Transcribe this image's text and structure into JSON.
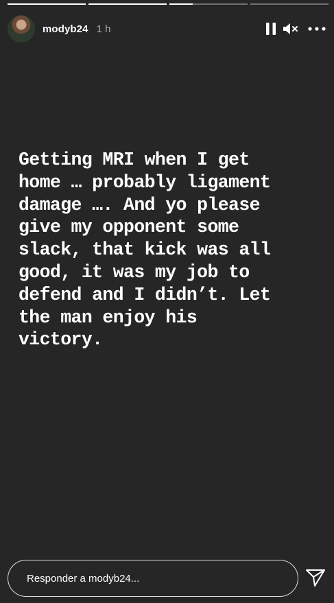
{
  "story": {
    "segments": [
      {
        "progress": 1.0
      },
      {
        "progress": 1.0
      },
      {
        "progress": 0.3
      },
      {
        "progress": 0.0
      }
    ],
    "text": "Getting MRI when I get\nhome … probably ligament\ndamage …. And yo please\ngive my opponent some\nslack, that kick was all\ngood, it was my job to\ndefend and I didn’t. Let\nthe man enjoy his\nvictory."
  },
  "header": {
    "username": "modyb24",
    "time": "1 h",
    "icons": {
      "avatar": "profile-photo",
      "pause": "pause-icon",
      "mute": "speaker-muted-icon",
      "more": "more-options-icon"
    }
  },
  "reply": {
    "placeholder": "Responder a modyb24...",
    "send_icon": "paper-plane-icon"
  },
  "colors": {
    "background": "#262626",
    "text": "#ffffff"
  }
}
